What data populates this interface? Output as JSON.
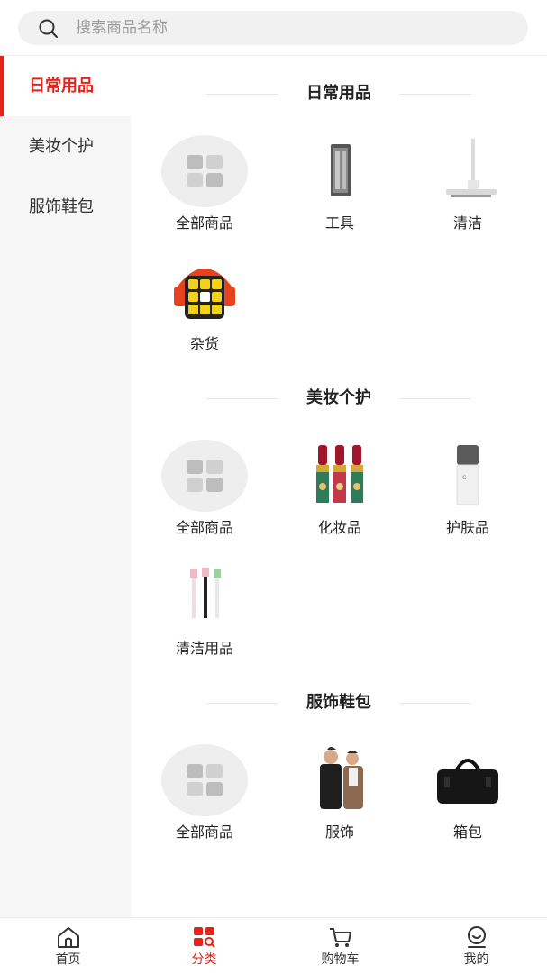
{
  "search": {
    "placeholder": "搜索商品名称"
  },
  "sidebar": {
    "items": [
      {
        "label": "日常用品",
        "active": true
      },
      {
        "label": "美妆个护",
        "active": false
      },
      {
        "label": "服饰鞋包",
        "active": false
      }
    ]
  },
  "sections": [
    {
      "title": "日常用品",
      "items": [
        {
          "label": "全部商品",
          "icon": "all-goods-grid-icon"
        },
        {
          "label": "工具",
          "icon": "tool-kit-image"
        },
        {
          "label": "清洁",
          "icon": "mop-image"
        },
        {
          "label": "杂货",
          "icon": "rubiks-cube-image"
        }
      ]
    },
    {
      "title": "美妆个护",
      "items": [
        {
          "label": "全部商品",
          "icon": "all-goods-grid-icon"
        },
        {
          "label": "化妆品",
          "icon": "lipsticks-image"
        },
        {
          "label": "护肤品",
          "icon": "skincare-bottle-image"
        },
        {
          "label": "清洁用品",
          "icon": "toothbrush-heads-image"
        }
      ]
    },
    {
      "title": "服饰鞋包",
      "items": [
        {
          "label": "全部商品",
          "icon": "all-goods-grid-icon"
        },
        {
          "label": "服饰",
          "icon": "clothing-models-image"
        },
        {
          "label": "箱包",
          "icon": "briefcase-image"
        }
      ]
    }
  ],
  "tabbar": {
    "tabs": [
      {
        "label": "首页",
        "icon": "home-icon",
        "active": false
      },
      {
        "label": "分类",
        "icon": "category-icon",
        "active": true
      },
      {
        "label": "购物车",
        "icon": "cart-icon",
        "active": false
      },
      {
        "label": "我的",
        "icon": "profile-icon",
        "active": false
      }
    ]
  },
  "colors": {
    "accent": "#e4221a",
    "sidebar_bg": "#f6f6f6",
    "search_bg": "#f1f1f1"
  }
}
